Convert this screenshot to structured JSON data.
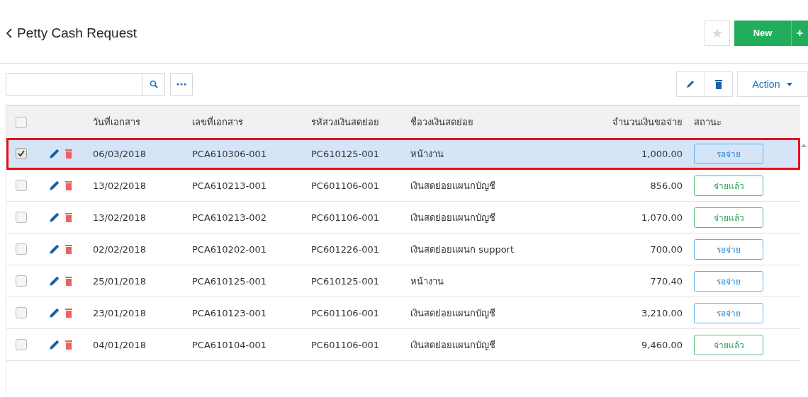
{
  "header": {
    "title": "Petty Cash Request",
    "new_button": "New",
    "plus_button": "+"
  },
  "toolbar": {
    "action_button": "Action"
  },
  "table": {
    "columns": [
      "วันที่เอกสาร",
      "เลขที่เอกสาร",
      "รหัสวงเงินสดย่อย",
      "ชื่อวงเงินสดย่อย",
      "จำนวนเงินขอจ่าย",
      "สถานะ"
    ],
    "header_checked": false,
    "rows": [
      {
        "selected": true,
        "checked": true,
        "date": "06/03/2018",
        "doc_no": "PCA610306-001",
        "fund_code": "PC610125-001",
        "fund_name": "หน้างาน",
        "amount": "1,000.00",
        "status": {
          "kind": "pending",
          "label": "รอจ่าย"
        }
      },
      {
        "selected": false,
        "checked": false,
        "date": "13/02/2018",
        "doc_no": "PCA610213-001",
        "fund_code": "PC601106-001",
        "fund_name": "เงินสดย่อยแผนกบัญชี",
        "amount": "856.00",
        "status": {
          "kind": "paid",
          "label": "จ่ายแล้ว"
        }
      },
      {
        "selected": false,
        "checked": false,
        "date": "13/02/2018",
        "doc_no": "PCA610213-002",
        "fund_code": "PC601106-001",
        "fund_name": "เงินสดย่อยแผนกบัญชี",
        "amount": "1,070.00",
        "status": {
          "kind": "paid",
          "label": "จ่ายแล้ว"
        }
      },
      {
        "selected": false,
        "checked": false,
        "date": "02/02/2018",
        "doc_no": "PCA610202-001",
        "fund_code": "PC601226-001",
        "fund_name": "เงินสดย่อยแผนก support",
        "amount": "700.00",
        "status": {
          "kind": "pending",
          "label": "รอจ่าย"
        }
      },
      {
        "selected": false,
        "checked": false,
        "date": "25/01/2018",
        "doc_no": "PCA610125-001",
        "fund_code": "PC610125-001",
        "fund_name": "หน้างาน",
        "amount": "770.40",
        "status": {
          "kind": "pending",
          "label": "รอจ่าย"
        }
      },
      {
        "selected": false,
        "checked": false,
        "date": "23/01/2018",
        "doc_no": "PCA610123-001",
        "fund_code": "PC601106-001",
        "fund_name": "เงินสดย่อยแผนกบัญชี",
        "amount": "3,210.00",
        "status": {
          "kind": "pending",
          "label": "รอจ่าย"
        }
      },
      {
        "selected": false,
        "checked": false,
        "date": "04/01/2018",
        "doc_no": "PCA610104-001",
        "fund_code": "PC601106-001",
        "fund_name": "เงินสดย่อยแผนกบัญชี",
        "amount": "9,460.00",
        "status": {
          "kind": "paid",
          "label": "จ่ายแล้ว"
        }
      }
    ]
  }
}
